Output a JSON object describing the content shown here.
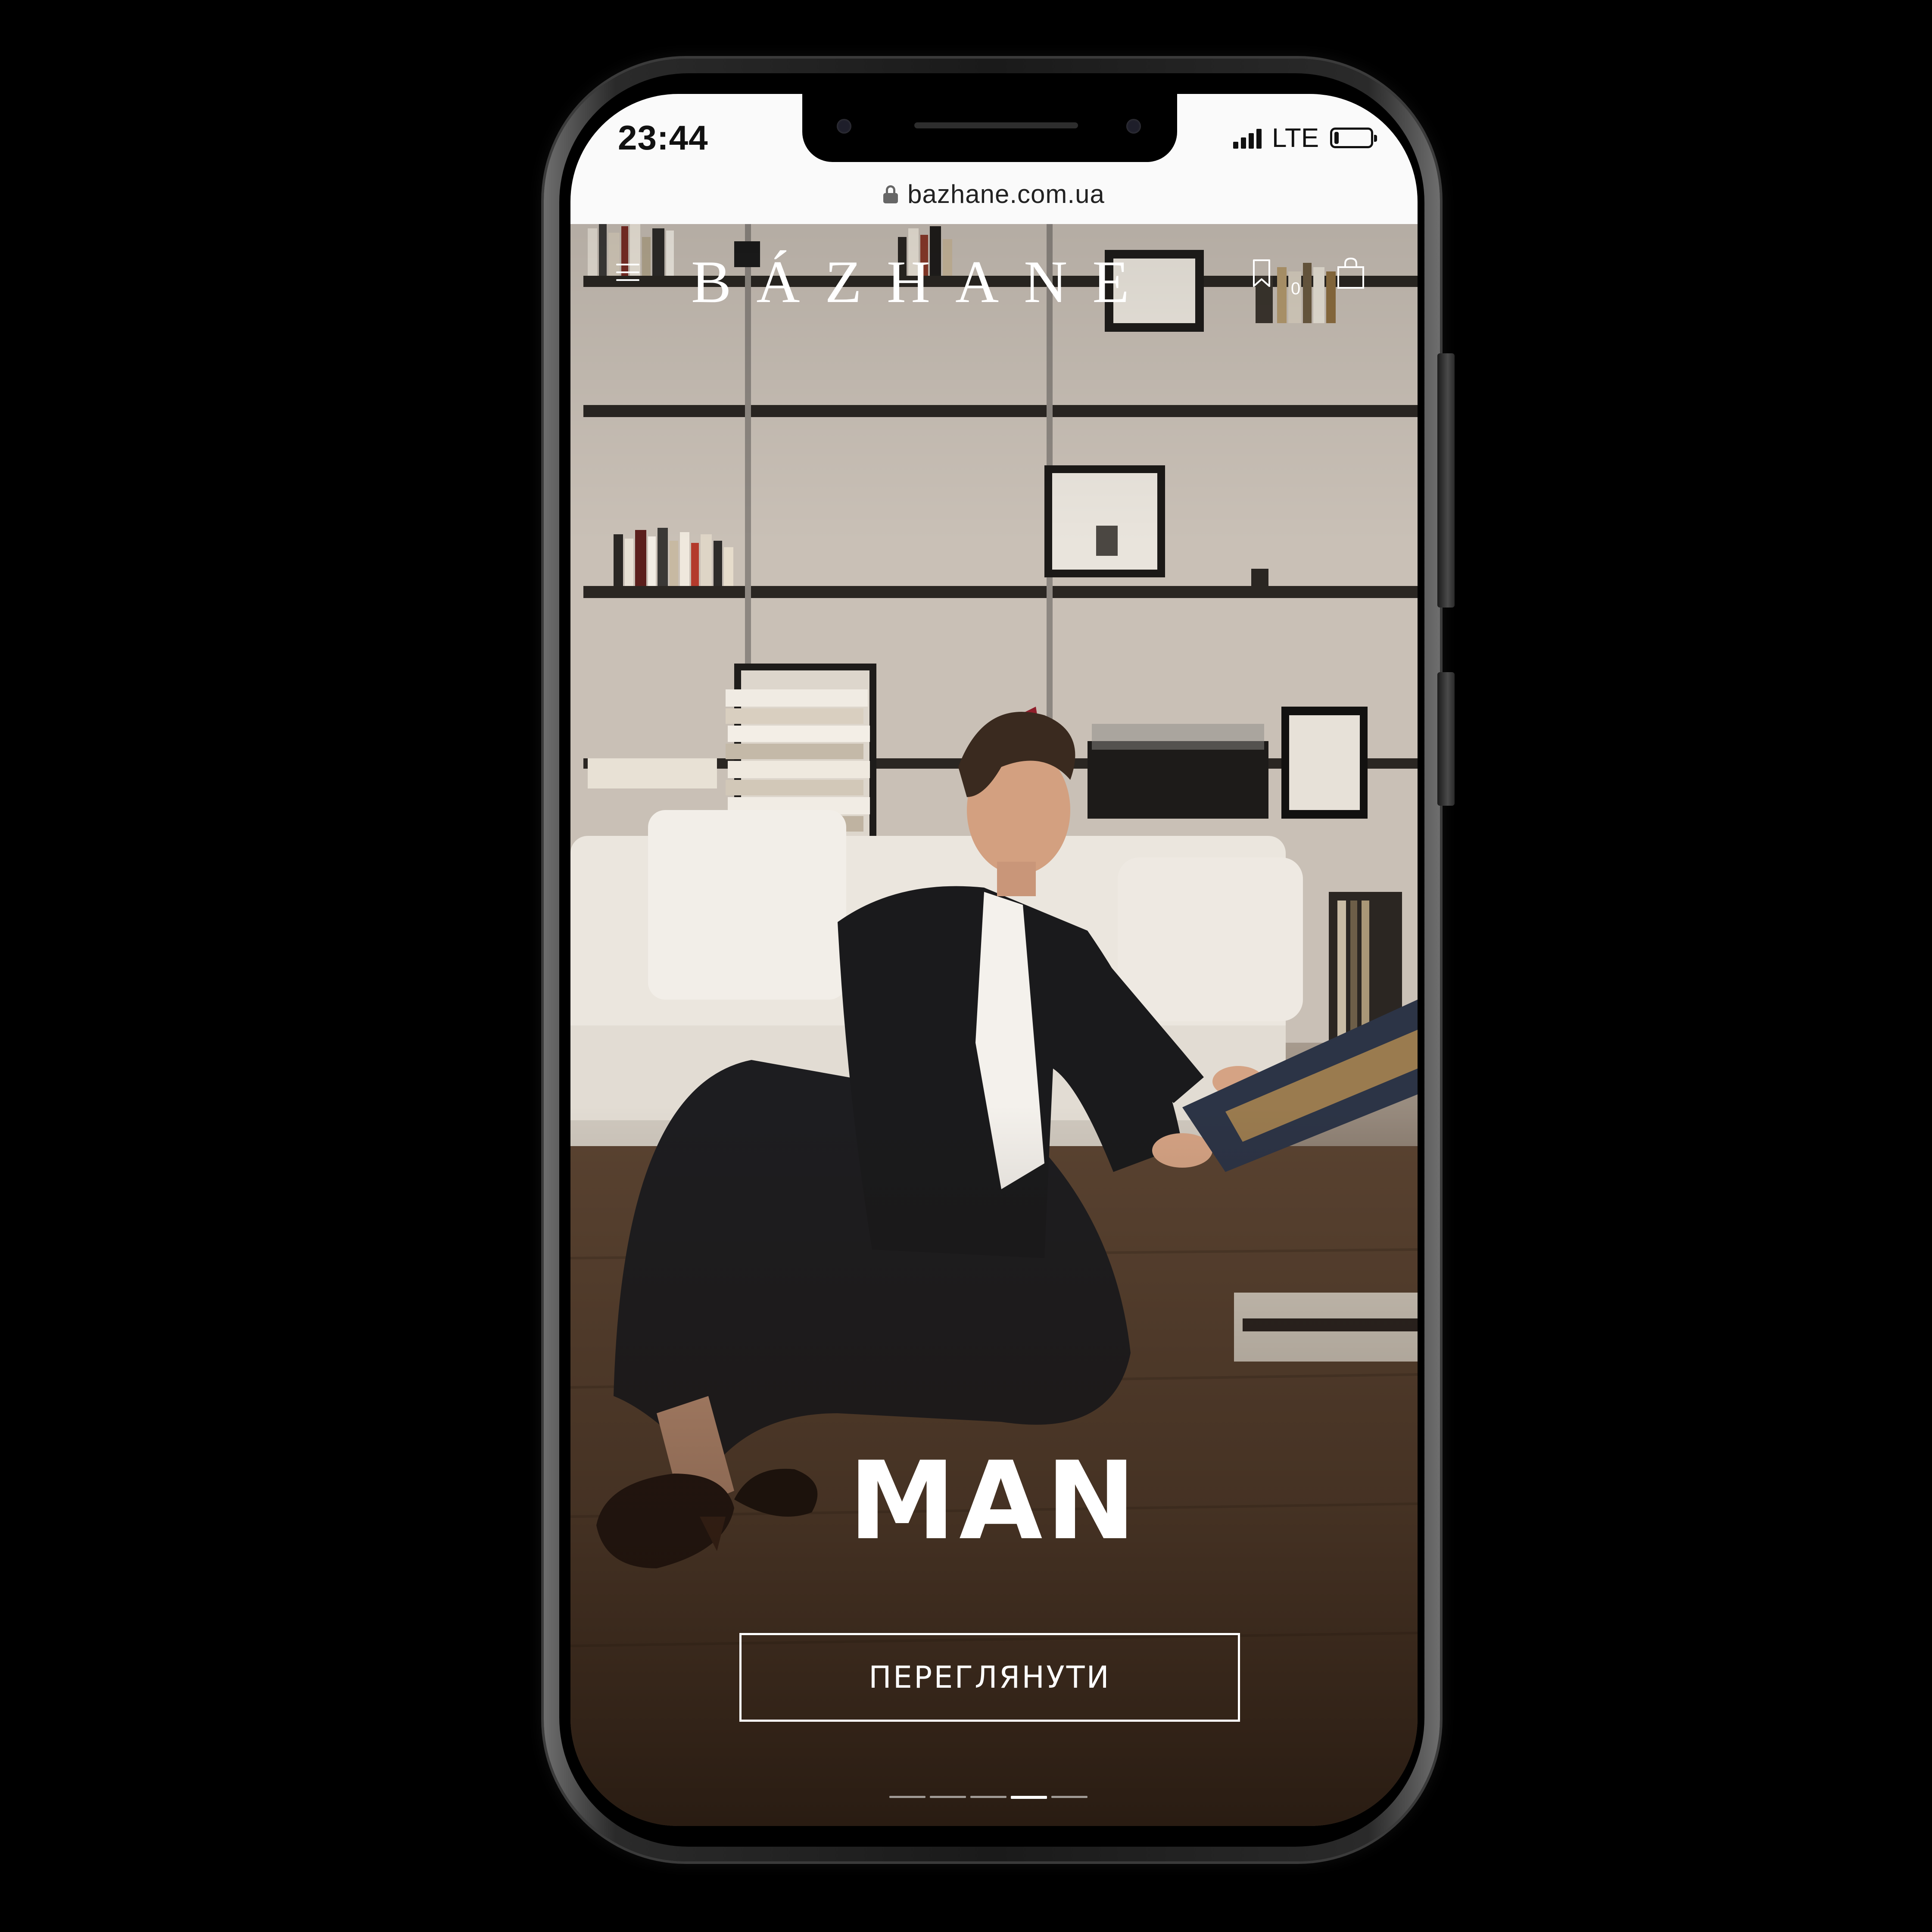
{
  "status_bar": {
    "time": "23:44",
    "network": "LTE",
    "battery_level": 0.12
  },
  "browser": {
    "url": "bazhane.com.ua",
    "lock_icon": "lock-icon"
  },
  "site_header": {
    "brand": "BÁZHANE",
    "menu_icon": "hamburger-menu-icon",
    "wishlist_icon": "bookmark-icon",
    "wishlist_count": "0",
    "cart_icon": "shopping-bag-icon"
  },
  "hero": {
    "title": "MAN",
    "cta_label": "ПЕРЕГЛЯНУТИ",
    "slides_total": 5,
    "active_slide": 4
  },
  "colors": {
    "screen_top": "#fafafa",
    "text_light": "#ffffff",
    "hero_dark": "#2a1f17"
  }
}
